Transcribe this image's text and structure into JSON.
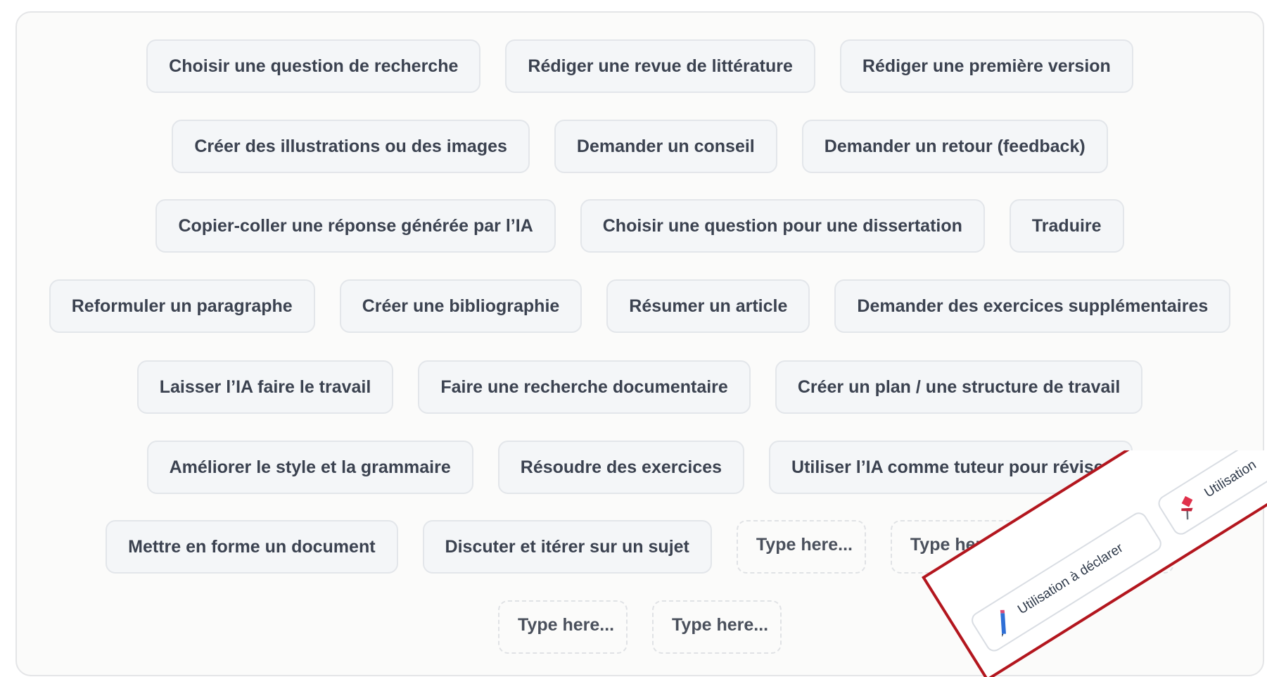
{
  "board": {
    "rows": [
      [
        "Choisir une question de recherche",
        "Rédiger une revue de littérature",
        "Rédiger une première version"
      ],
      [
        "Créer des illustrations ou des images",
        "Demander un conseil",
        "Demander un retour (feedback)"
      ],
      [
        "Copier-coller une réponse générée par l’IA",
        "Choisir une question pour une dissertation",
        "Traduire"
      ],
      [
        "Reformuler un paragraphe",
        "Créer une bibliographie",
        "Résumer un article",
        "Demander des exercices supplémentaires"
      ],
      [
        "Laisser l’IA faire le travail",
        "Faire une recherche documentaire",
        "Créer un plan / une structure de travail"
      ],
      [
        "Améliorer le style et la grammaire",
        "Résoudre des exercices",
        "Utiliser l’IA comme tuteur pour réviser"
      ],
      [
        "Mettre en forme un document",
        "Discuter et itérer sur un sujet"
      ],
      []
    ],
    "input_placeholder": "Type here...",
    "row7_inputs": 3,
    "row8_inputs": 2
  },
  "overlay": {
    "tag_declare_label": "Utilisation à déclarer",
    "tag_declare_icon": "pencil-icon",
    "tag_other_label": "Utilisation",
    "tag_other_icon": "pushpin-icon",
    "highlight_color": "#b3161e"
  }
}
